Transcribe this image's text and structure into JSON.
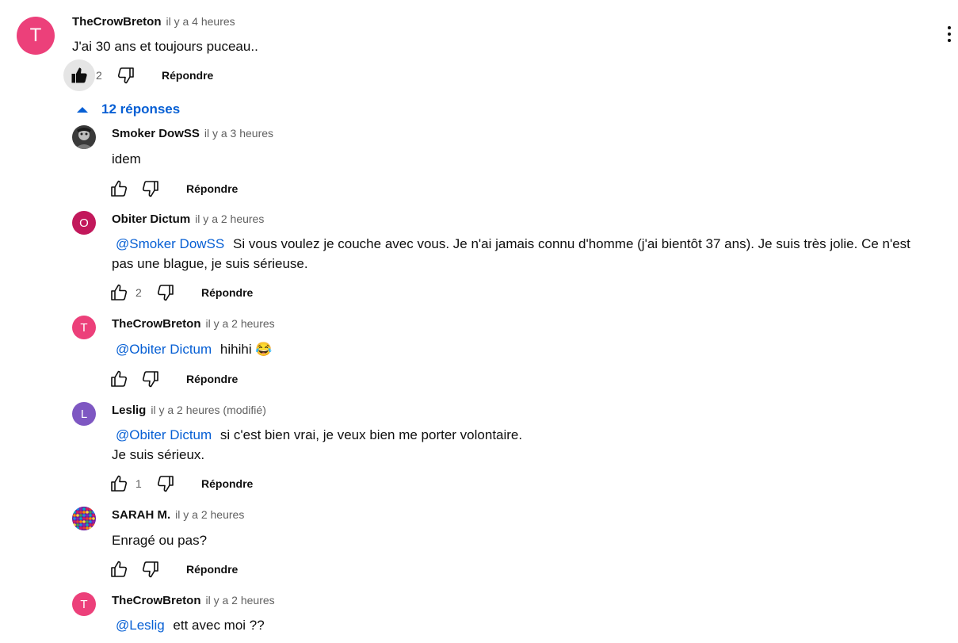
{
  "main_comment": {
    "author": "TheCrowBreton",
    "time": "il y a 4 heures",
    "avatar_letter": "T",
    "avatar_color": "#ec407a",
    "text": "J'ai 30 ans et toujours puceau..",
    "likes": "2",
    "reply_label": "Répondre",
    "liked": true
  },
  "replies_toggle": {
    "label": "12 réponses",
    "color": "#065fd4"
  },
  "replies": [
    {
      "author": "Smoker DowSS",
      "time": "il y a 3 heures",
      "avatar_type": "photo",
      "mention": "",
      "text": "idem",
      "text2": "",
      "likes": "",
      "reply_label": "Répondre"
    },
    {
      "author": "Obiter Dictum",
      "time": "il y a 2 heures",
      "avatar_letter": "O",
      "avatar_color": "#c2185b",
      "mention": "@Smoker DowSS",
      "text": "Si vous voulez je couche avec vous. Je n'ai jamais connu d'homme (j'ai bientôt 37 ans). Je suis très jolie. Ce n'est",
      "text2": "pas une blague, je suis sérieuse.",
      "likes": "2",
      "reply_label": "Répondre"
    },
    {
      "author": "TheCrowBreton",
      "time": "il y a 2 heures",
      "avatar_letter": "T",
      "avatar_color": "#ec407a",
      "mention": "@Obiter Dictum",
      "text": "hihihi 😂",
      "text2": "",
      "likes": "",
      "reply_label": "Répondre"
    },
    {
      "author": "Leslig",
      "time": "il y a 2 heures (modifié)",
      "avatar_letter": "L",
      "avatar_color": "#7e57c2",
      "mention": "@Obiter Dictum",
      "text": "si c'est bien vrai, je veux bien me porter volontaire.",
      "text2": "Je suis sérieux.",
      "likes": "1",
      "reply_label": "Répondre"
    },
    {
      "author": "SARAH M.",
      "time": "il y a 2 heures",
      "avatar_type": "photo-colorful",
      "mention": "",
      "text": "Enragé ou pas?",
      "text2": "",
      "likes": "",
      "reply_label": "Répondre"
    },
    {
      "author": "TheCrowBreton",
      "time": "il y a 2 heures",
      "avatar_letter": "T",
      "avatar_color": "#ec407a",
      "mention": "@Leslig",
      "text": "ett avec moi ??",
      "text2": "",
      "likes": "",
      "reply_label": ""
    }
  ],
  "icons": {
    "like": "thumbs-up-icon",
    "dislike": "thumbs-down-icon",
    "more": "more-vert-icon",
    "toggle": "caret-up-icon"
  }
}
